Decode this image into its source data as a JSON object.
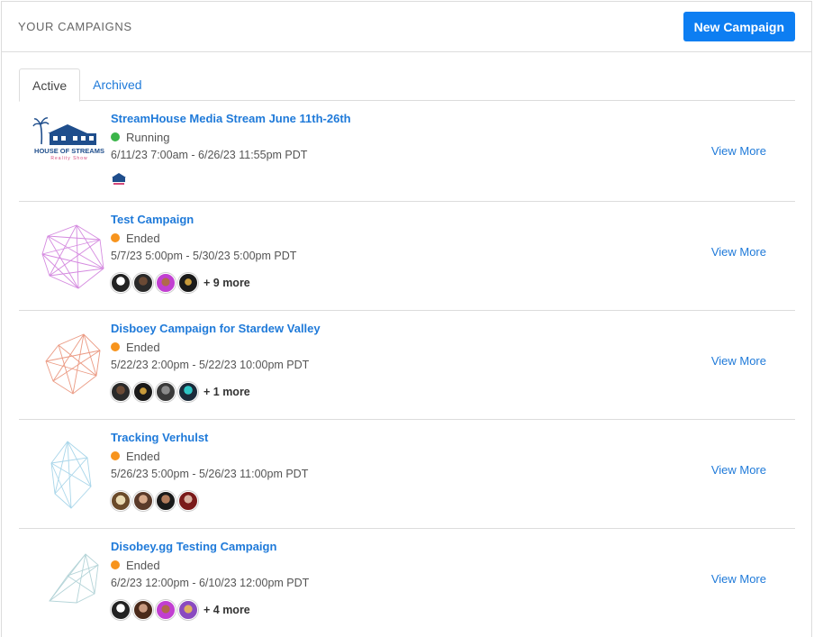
{
  "header": {
    "title": "YOUR CAMPAIGNS",
    "new_campaign_label": "New Campaign"
  },
  "tabs": [
    {
      "label": "Active",
      "active": true
    },
    {
      "label": "Archived",
      "active": false
    }
  ],
  "view_more_label": "View More",
  "colors": {
    "accent": "#0d7ef2",
    "link": "#1f7ad9",
    "running": "#3bb54a",
    "ended": "#f7941d"
  },
  "campaigns": [
    {
      "title": "StreamHouse Media Stream June 11th-26th",
      "status": "Running",
      "dates": "6/11/23 7:00am - 6/26/23 11:55pm PDT",
      "more": "",
      "logo_text": "HOUSE OF STREAMS",
      "logo_subtext": "Reality Show"
    },
    {
      "title": "Test Campaign",
      "status": "Ended",
      "dates": "5/7/23 5:00pm - 5/30/23 5:00pm PDT",
      "more": "+ 9 more"
    },
    {
      "title": "Disboey Campaign for Stardew Valley",
      "status": "Ended",
      "dates": "5/22/23 2:00pm - 5/22/23 10:00pm PDT",
      "more": "+ 1 more"
    },
    {
      "title": "Tracking Verhulst",
      "status": "Ended",
      "dates": "5/26/23 5:00pm - 5/26/23 11:00pm PDT",
      "more": ""
    },
    {
      "title": "Disobey.gg Testing Campaign",
      "status": "Ended",
      "dates": "6/2/23 12:00pm - 6/10/23 12:00pm PDT",
      "more": "+ 4 more"
    }
  ]
}
